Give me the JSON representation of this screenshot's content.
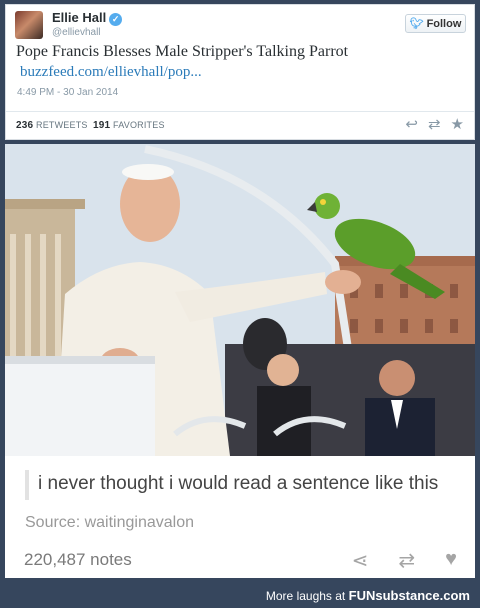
{
  "tweet": {
    "user_name": "Ellie Hall",
    "handle": "@ellievhall",
    "follow_label": "Follow",
    "text": "Pope Francis Blesses Male Stripper's Talking Parrot",
    "link": "buzzfeed.com/ellievhall/pop...",
    "timestamp": "4:49 PM - 30 Jan 2014",
    "retweets_count": "236",
    "retweets_label": "RETWEETS",
    "favorites_count": "191",
    "favorites_label": "FAVORITES",
    "icons": [
      "reply-icon",
      "retweet-icon",
      "favorite-star-icon"
    ]
  },
  "post": {
    "quote": "i never thought i would read a sentence like this",
    "source": "Source: waitinginavalon",
    "notes": "220,487 notes",
    "icons": [
      "share-icon",
      "reblog-icon",
      "like-heart-icon"
    ]
  },
  "footer": {
    "text": "More laughs at",
    "brand": "FUNsubstance.com"
  },
  "colors": {
    "background": "#36465d",
    "twitter_blue": "#55acee",
    "link_blue": "#2b7bb9"
  }
}
